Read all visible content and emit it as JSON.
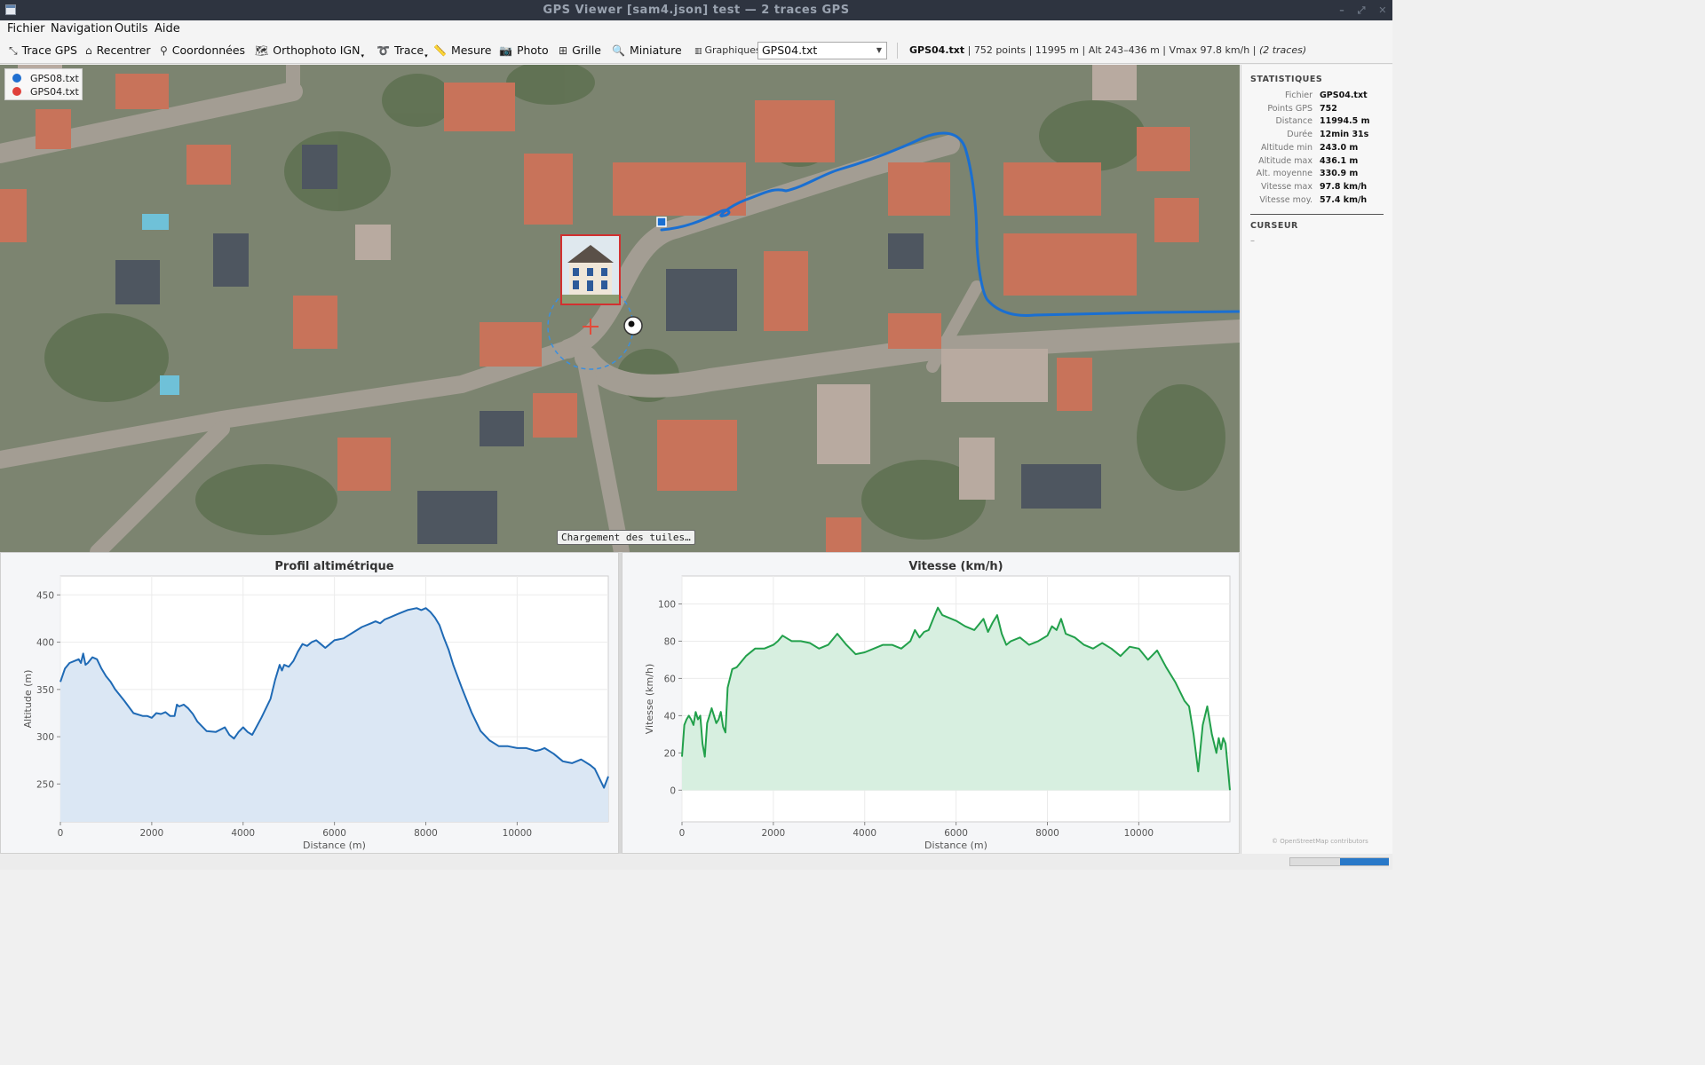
{
  "window": {
    "title": "GPS Viewer  [sam4.json]  test — 2 traces GPS",
    "controls": [
      "–",
      "⤢",
      "✕"
    ]
  },
  "menu": [
    "Fichier",
    "Navigation",
    "Outils",
    "Aide"
  ],
  "toolbar": {
    "buttons": [
      {
        "icon": "⤡",
        "label": "Trace GPS"
      },
      {
        "icon": "⌂",
        "label": "Recentrer"
      },
      {
        "icon": "⚲",
        "label": "Coordonnées"
      },
      {
        "icon": "🗺",
        "label": "Orthophoto IGN"
      },
      {
        "icon": "➰",
        "label": "Trace"
      },
      {
        "icon": "📏",
        "label": "Mesure"
      },
      {
        "icon": "📷",
        "label": "Photo"
      },
      {
        "icon": "⊞",
        "label": "Grille"
      },
      {
        "icon": "🔍",
        "label": "Miniature"
      }
    ],
    "graph_label": "Graphiques :",
    "graph_select": "GPS04.txt",
    "info": {
      "file": "GPS04.txt",
      "rest": " | 752 points | 11995 m | Alt 243–436 m | Vmax 97.8 km/h | ",
      "traces": "(2 traces)"
    }
  },
  "map": {
    "legend": [
      {
        "name": "GPS08.txt",
        "color": "#1f6fd0"
      },
      {
        "name": "GPS04.txt",
        "color": "#e0413a"
      }
    ],
    "loading": "Chargement des tuiles…",
    "track_color": "#1a6fd1",
    "cursor_color": "#e24a3a"
  },
  "stats": {
    "title": "STATISTIQUES",
    "rows": [
      {
        "k": "Fichier",
        "v": "GPS04.txt"
      },
      {
        "k": "Points GPS",
        "v": "752"
      },
      {
        "k": "Distance",
        "v": "11994.5 m"
      },
      {
        "k": "Durée",
        "v": "12min 31s"
      },
      {
        "k": "Altitude min",
        "v": "243.0 m"
      },
      {
        "k": "Altitude max",
        "v": "436.1 m"
      },
      {
        "k": "Alt. moyenne",
        "v": "330.9 m"
      },
      {
        "k": "Vitesse max",
        "v": "97.8 km/h"
      },
      {
        "k": "Vitesse moy.",
        "v": "57.4 km/h"
      }
    ],
    "cursor_title": "CURSEUR",
    "cursor_value": "–",
    "credit": "© OpenStreetMap contributors"
  },
  "chart_data": [
    {
      "type": "area",
      "title": "Profil altimétrique",
      "xlabel": "Distance (m)",
      "ylabel": "Altitude (m)",
      "xlim": [
        0,
        11995
      ],
      "ylim": [
        210,
        470
      ],
      "xticks": [
        0,
        2000,
        4000,
        6000,
        8000,
        10000
      ],
      "yticks": [
        250,
        300,
        350,
        400,
        450
      ],
      "grid": true,
      "color": "#1f6ab5",
      "fill": "#dbe7f4",
      "x": [
        0,
        100,
        200,
        300,
        400,
        450,
        500,
        550,
        600,
        700,
        800,
        900,
        1000,
        1100,
        1200,
        1400,
        1600,
        1800,
        1900,
        2000,
        2100,
        2200,
        2300,
        2400,
        2500,
        2550,
        2600,
        2700,
        2800,
        2900,
        3000,
        3200,
        3400,
        3600,
        3700,
        3800,
        3900,
        4000,
        4100,
        4200,
        4400,
        4600,
        4700,
        4800,
        4850,
        4900,
        5000,
        5100,
        5200,
        5300,
        5400,
        5500,
        5600,
        5700,
        5800,
        5900,
        6000,
        6200,
        6400,
        6600,
        6800,
        6900,
        7000,
        7100,
        7200,
        7400,
        7600,
        7800,
        7900,
        8000,
        8100,
        8200,
        8300,
        8400,
        8500,
        8600,
        8800,
        9000,
        9200,
        9400,
        9600,
        9800,
        10000,
        10200,
        10400,
        10500,
        10600,
        10800,
        11000,
        11200,
        11400,
        11600,
        11700,
        11800,
        11900,
        11995
      ],
      "values": [
        358,
        372,
        378,
        380,
        382,
        378,
        388,
        376,
        378,
        384,
        382,
        372,
        364,
        358,
        350,
        338,
        325,
        322,
        322,
        320,
        325,
        324,
        326,
        322,
        322,
        334,
        332,
        334,
        330,
        324,
        316,
        306,
        305,
        310,
        302,
        298,
        305,
        310,
        305,
        302,
        320,
        340,
        360,
        376,
        370,
        376,
        374,
        380,
        390,
        398,
        396,
        400,
        402,
        398,
        394,
        398,
        402,
        404,
        410,
        416,
        420,
        422,
        420,
        424,
        426,
        430,
        434,
        436,
        434,
        436,
        432,
        426,
        418,
        404,
        392,
        376,
        350,
        326,
        306,
        296,
        290,
        290,
        288,
        288,
        285,
        286,
        288,
        282,
        274,
        272,
        276,
        270,
        266,
        256,
        246,
        258
      ],
      "series_name": "GPS04.txt"
    },
    {
      "type": "area",
      "title": "Vitesse (km/h)",
      "xlabel": "Distance (m)",
      "ylabel": "Vitesse (km/h)",
      "xlim": [
        0,
        11995
      ],
      "ylim": [
        -17,
        115
      ],
      "xticks": [
        0,
        2000,
        4000,
        6000,
        8000,
        10000
      ],
      "yticks": [
        0,
        20,
        40,
        60,
        80,
        100
      ],
      "grid": true,
      "color": "#22a04b",
      "fill": "#d7efe0",
      "x": [
        0,
        50,
        100,
        150,
        200,
        250,
        300,
        350,
        400,
        450,
        500,
        550,
        600,
        650,
        700,
        750,
        800,
        850,
        900,
        950,
        1000,
        1100,
        1200,
        1400,
        1600,
        1800,
        2000,
        2100,
        2200,
        2400,
        2600,
        2800,
        3000,
        3200,
        3400,
        3600,
        3800,
        4000,
        4200,
        4400,
        4600,
        4800,
        5000,
        5100,
        5200,
        5300,
        5400,
        5500,
        5600,
        5700,
        5800,
        6000,
        6200,
        6400,
        6600,
        6700,
        6800,
        6900,
        7000,
        7100,
        7200,
        7400,
        7600,
        7800,
        8000,
        8100,
        8200,
        8300,
        8400,
        8600,
        8800,
        9000,
        9200,
        9400,
        9600,
        9800,
        10000,
        10200,
        10400,
        10600,
        10800,
        11000,
        11100,
        11200,
        11300,
        11400,
        11500,
        11600,
        11700,
        11750,
        11800,
        11850,
        11900,
        11995
      ],
      "values": [
        18,
        35,
        38,
        40,
        38,
        35,
        42,
        38,
        40,
        25,
        18,
        36,
        40,
        44,
        40,
        36,
        38,
        42,
        34,
        31,
        55,
        65,
        66,
        72,
        76,
        76,
        78,
        80,
        83,
        80,
        80,
        79,
        76,
        78,
        84,
        78,
        73,
        74,
        76,
        78,
        78,
        76,
        80,
        86,
        82,
        85,
        86,
        92,
        98,
        94,
        93,
        91,
        88,
        86,
        92,
        85,
        90,
        94,
        84,
        78,
        80,
        82,
        78,
        80,
        83,
        88,
        86,
        92,
        84,
        82,
        78,
        76,
        79,
        76,
        72,
        77,
        76,
        70,
        75,
        66,
        58,
        48,
        45,
        30,
        10,
        35,
        45,
        30,
        20,
        28,
        22,
        28,
        25,
        0
      ],
      "series_name": "GPS04.txt"
    }
  ]
}
